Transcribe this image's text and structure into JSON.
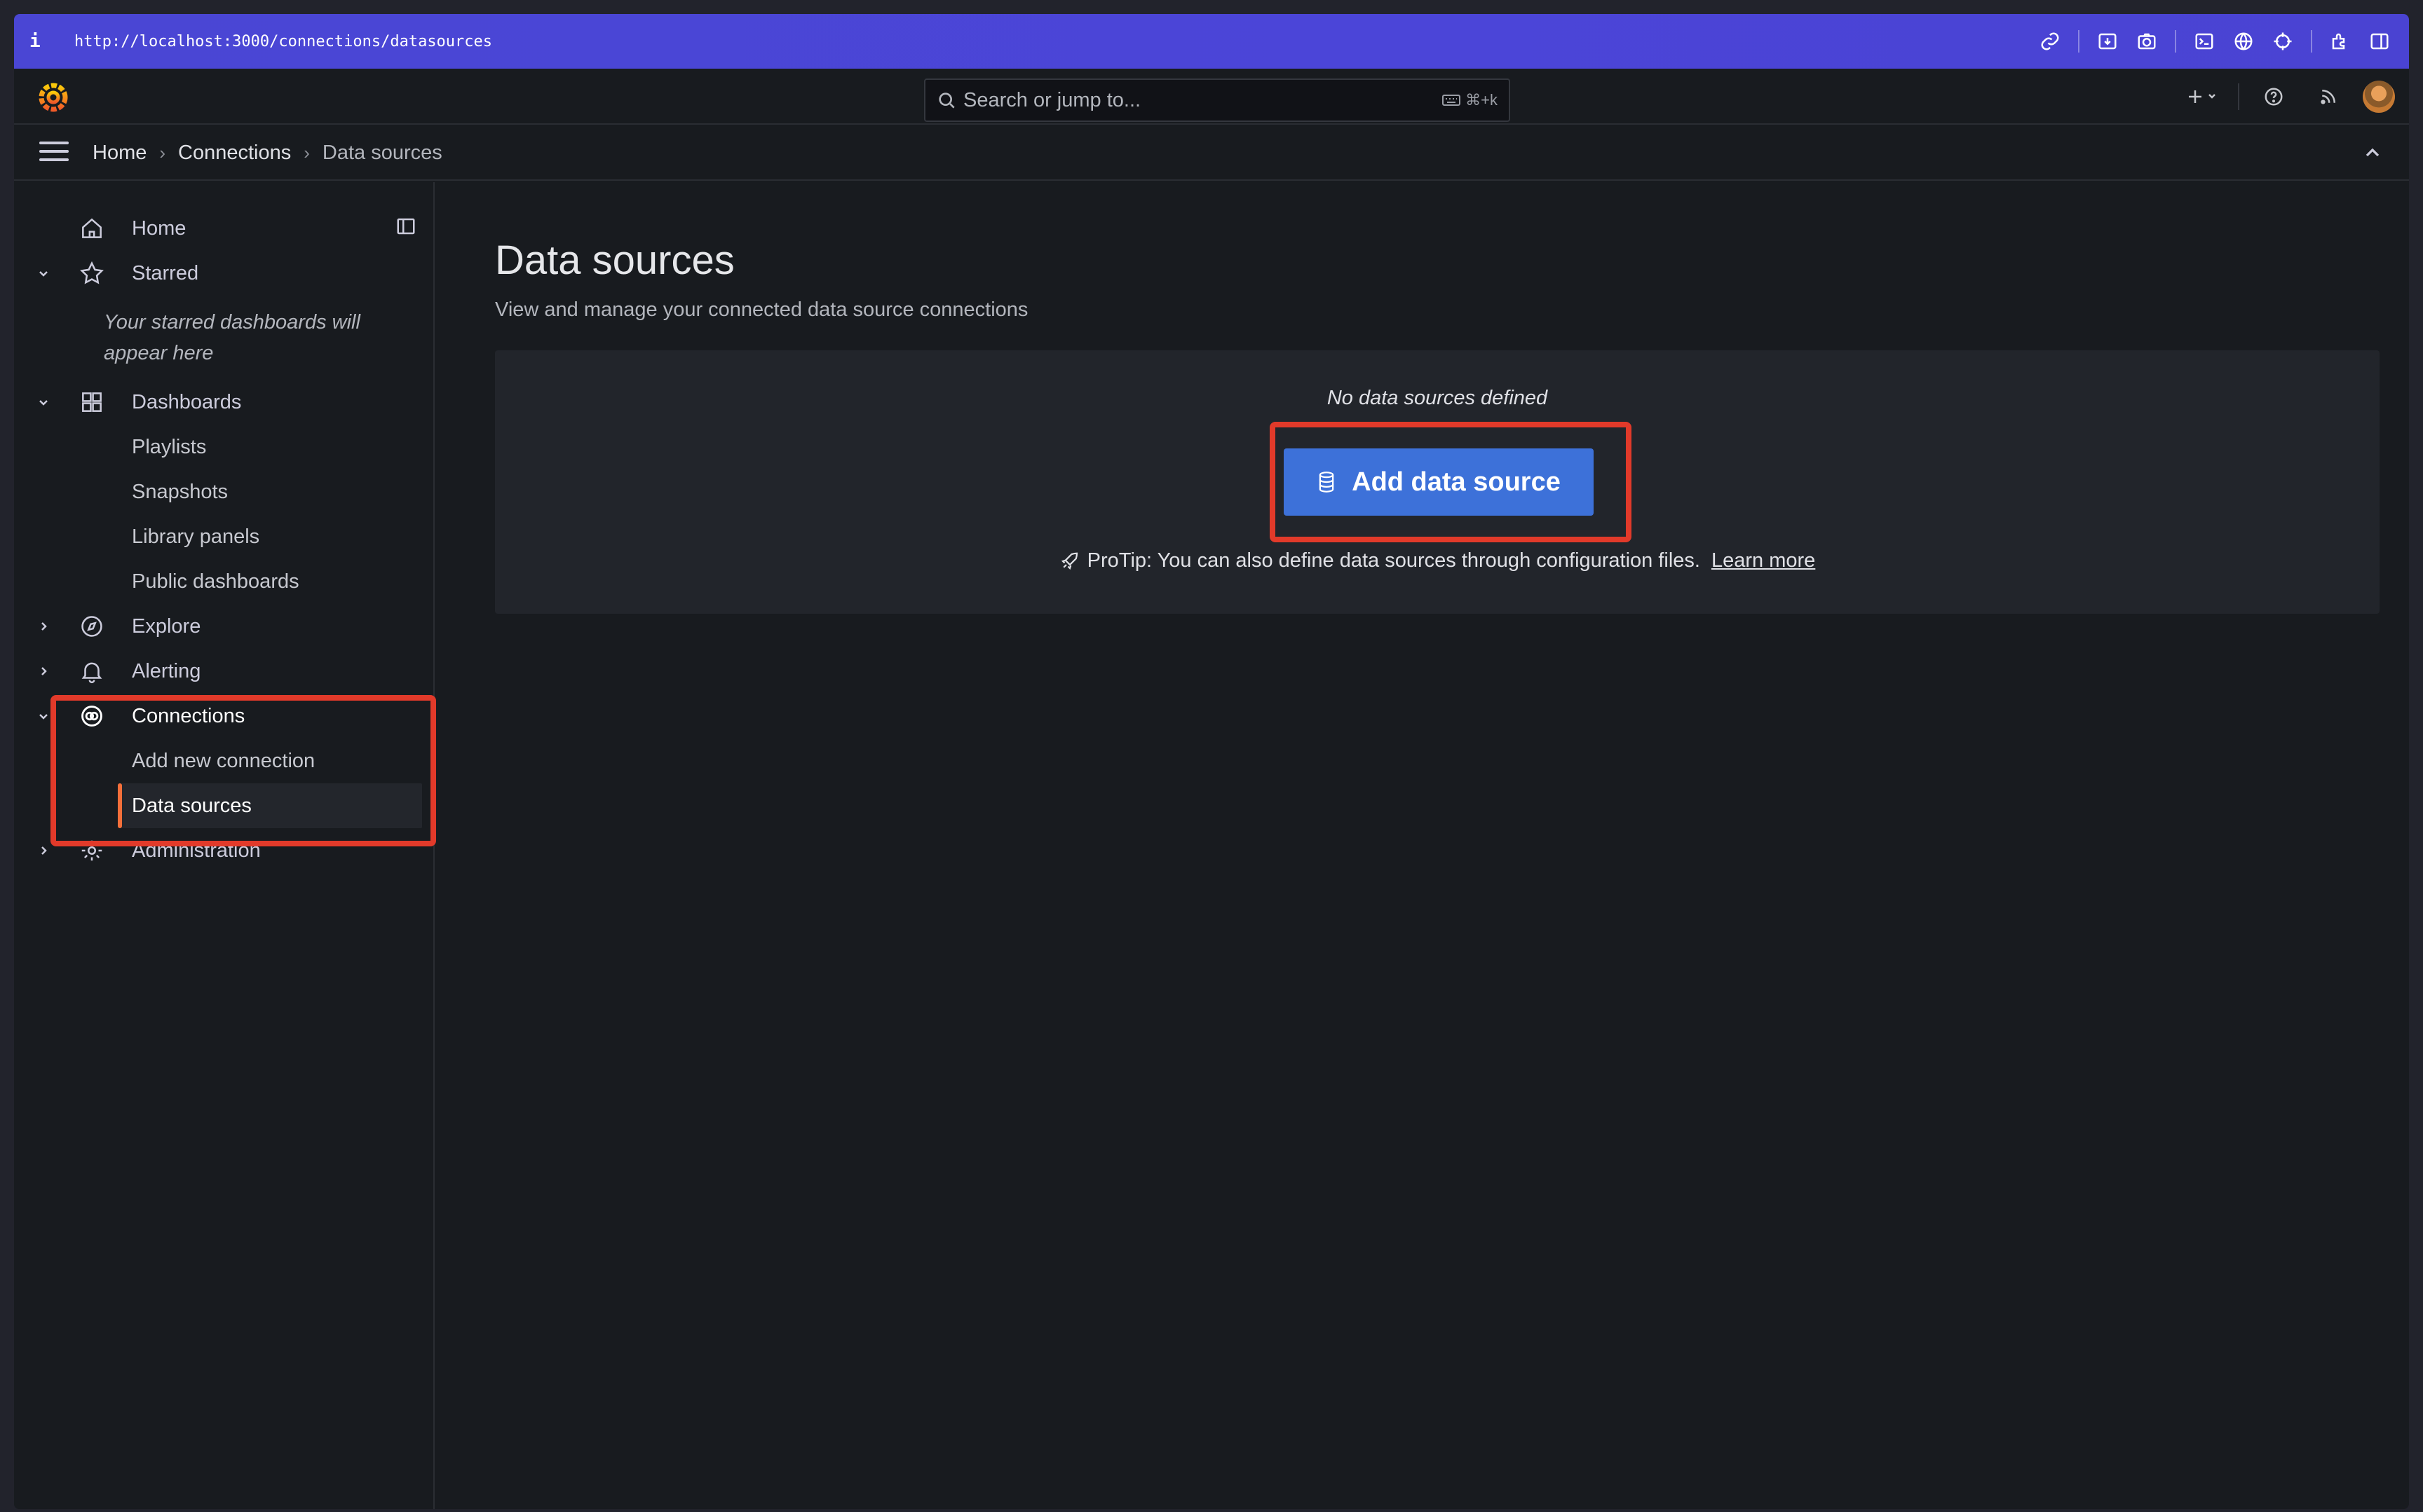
{
  "browser": {
    "info": "i",
    "url": "http://localhost:3000/connections/datasources"
  },
  "topnav": {
    "search_placeholder": "Search or jump to...",
    "shortcut": "⌘+k"
  },
  "breadcrumb": {
    "items": [
      "Home",
      "Connections",
      "Data sources"
    ]
  },
  "sidebar": {
    "home": "Home",
    "starred": "Starred",
    "starred_note": "Your starred dashboards will appear here",
    "dashboards": "Dashboards",
    "playlists": "Playlists",
    "snapshots": "Snapshots",
    "library_panels": "Library panels",
    "public_dashboards": "Public dashboards",
    "explore": "Explore",
    "alerting": "Alerting",
    "connections": "Connections",
    "add_new_connection": "Add new connection",
    "data_sources": "Data sources",
    "administration": "Administration"
  },
  "main": {
    "title": "Data sources",
    "subtitle": "View and manage your connected data source connections",
    "empty_message": "No data sources defined",
    "add_button": "Add data source",
    "protip": "ProTip: You can also define data sources through configuration files.",
    "learn_more": "Learn more"
  },
  "colors": {
    "accent": "#3d71d9",
    "active_indicator": "#f46f3a",
    "highlight": "#e23a2a",
    "browser_bar": "#4b45d8"
  }
}
